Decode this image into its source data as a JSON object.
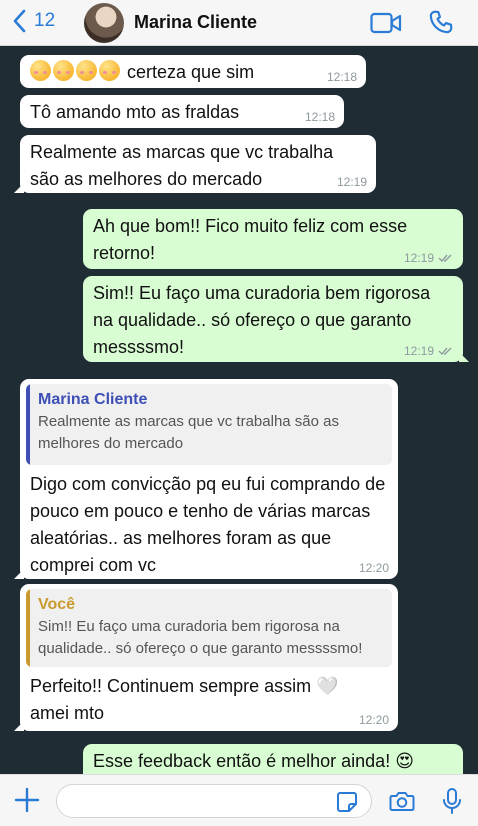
{
  "header": {
    "back_count": "12",
    "contact_name": "Marina Cliente"
  },
  "messages": [
    {
      "dir": "in",
      "text": "certeza que sim",
      "emoji_prefix": "🥰🥰🥰🥰",
      "time": "12:18"
    },
    {
      "dir": "in",
      "text": "Tô amando mto as fraldas",
      "time": "12:18"
    },
    {
      "dir": "in",
      "text": "Realmente as marcas que vc trabalha são as melhores do mercado",
      "time": "12:19"
    },
    {
      "dir": "out",
      "text": "Ah que bom!! Fico muito feliz com esse retorno!",
      "time": "12:19"
    },
    {
      "dir": "out",
      "text": "Sim!! Eu faço uma curadoria bem rigorosa na qualidade.. só ofereço o que garanto messssmo!",
      "time": "12:19"
    },
    {
      "dir": "in",
      "quote_author": "Marina Cliente",
      "quote_text": "Realmente as marcas que vc trabalha são as melhores do mercado",
      "text": "Digo com convicção pq eu fui comprando de pouco em pouco e tenho de várias marcas aleatórias.. as melhores foram as que comprei com vc",
      "time": "12:20"
    },
    {
      "dir": "in",
      "quote_author": "Você",
      "quote_text": "Sim!! Eu faço uma curadoria bem rigorosa na qualidade.. só ofereço o que garanto messssmo!",
      "text": "Perfeito!! Continuem sempre assim 🤍 amei mto",
      "time": "12:20"
    },
    {
      "dir": "out",
      "text": "Esse feedback então é melhor ainda! 😍",
      "time": ""
    }
  ],
  "input": {
    "value": ""
  },
  "colors": {
    "accent": "#2a7bd6",
    "outgoing": "#d9fdd3",
    "incoming": "#ffffff",
    "background": "#1f2c34"
  },
  "icons": [
    "chevron-left-icon",
    "video-call-icon",
    "phone-icon",
    "plus-icon",
    "sticker-icon",
    "camera-icon",
    "microphone-icon",
    "double-check-icon"
  ]
}
